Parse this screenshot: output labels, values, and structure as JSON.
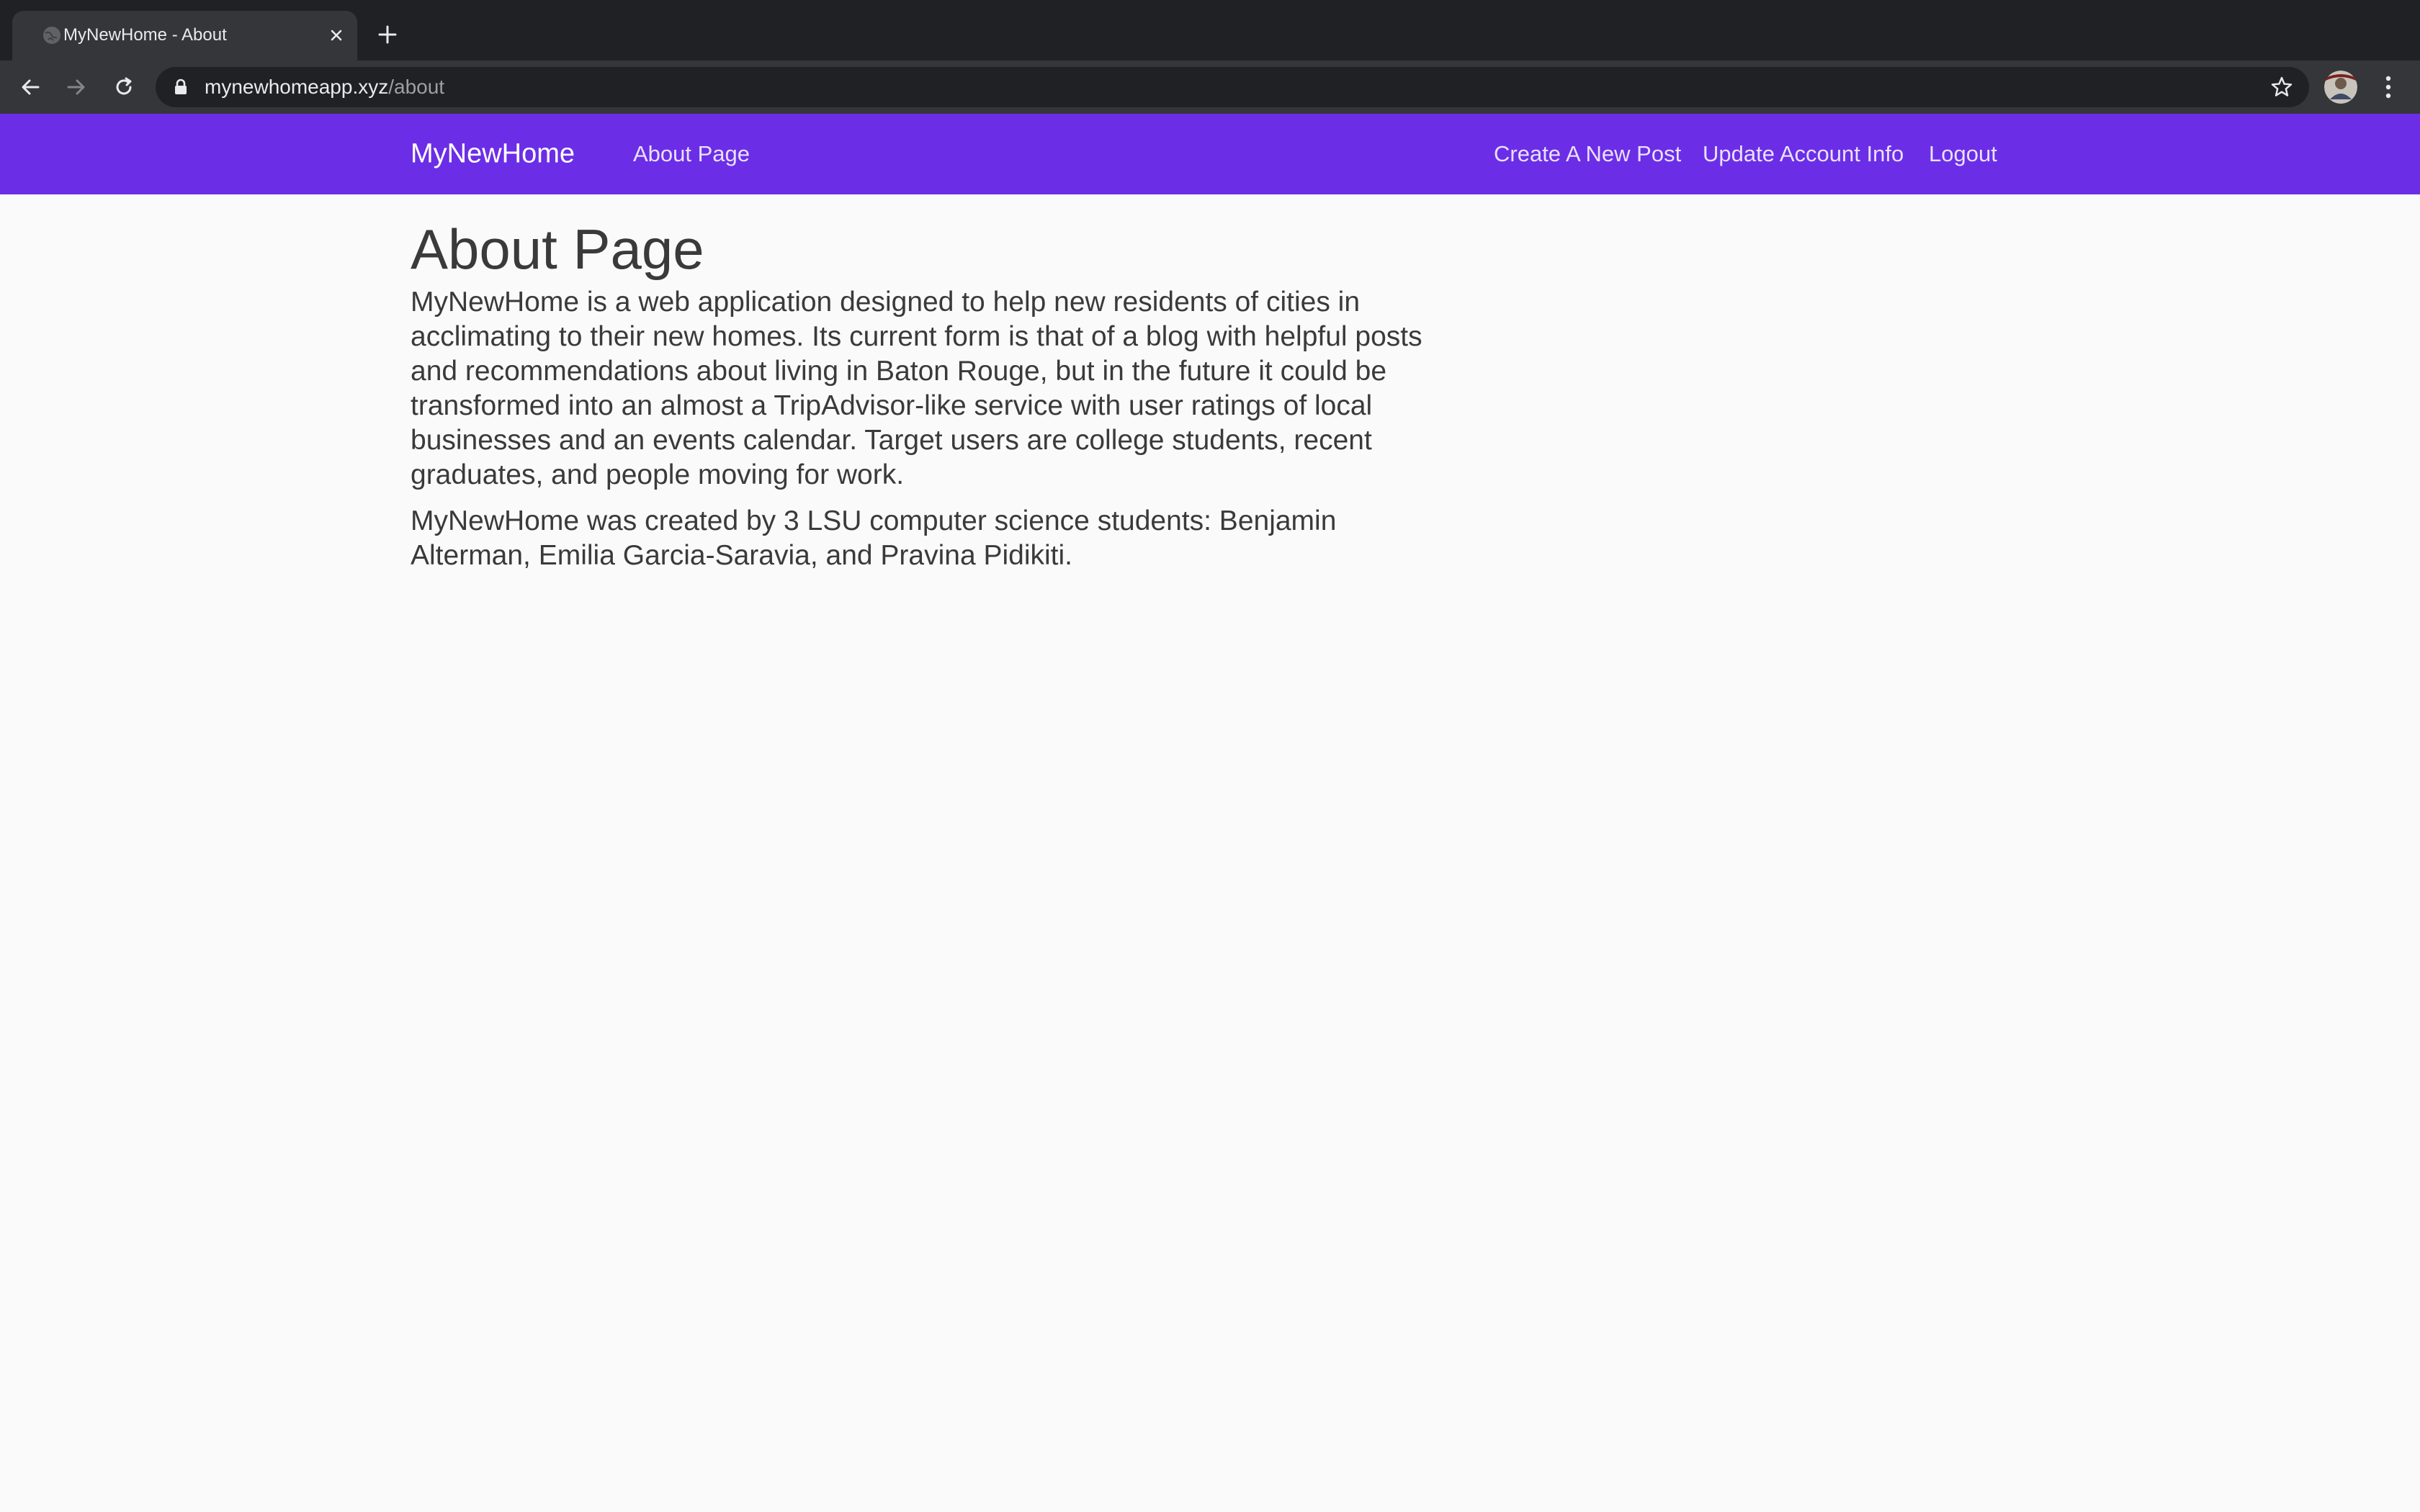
{
  "browser": {
    "tab_title": "MyNewHome - About",
    "url_host": "mynewhomeapp.xyz",
    "url_path": "/about"
  },
  "site": {
    "brand": "MyNewHome",
    "nav_left": [
      "About Page"
    ],
    "nav_right": [
      "Create A New Post",
      "Update Account Info",
      "Logout"
    ],
    "navbar_color": "#6b2ee6"
  },
  "page": {
    "title": "About Page",
    "paragraphs": [
      "MyNewHome is a web application designed to help new residents of cities in acclimating to their new homes. Its current form is that of a blog with helpful posts and recommendations about living in Baton Rouge, but in the future it could be transformed into an almost a TripAdvisor-like service with user ratings of local businesses and an events calendar. Target users are college students, recent graduates, and people moving for work.",
      "MyNewHome was created by 3 LSU computer science students: Benjamin Alterman, Emilia Garcia-Saravia, and Pravina Pidikiti."
    ]
  }
}
